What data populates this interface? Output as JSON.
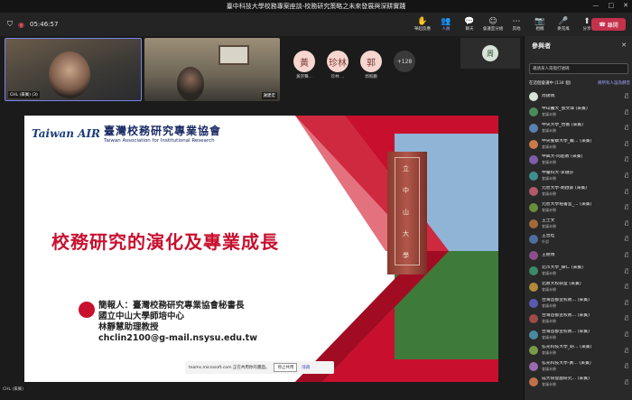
{
  "window": {
    "title": "臺中科技大學校務專案座談-校務研究策略之未來發展與深耕實踐",
    "controls": [
      "—",
      "□",
      "✕"
    ]
  },
  "toolbar": {
    "timer": "05:46:57",
    "tools": [
      {
        "icon": "✋",
        "label": "舉起反應"
      },
      {
        "icon": "👥",
        "label": "人員",
        "active": true
      },
      {
        "icon": "💬",
        "label": "聊天"
      },
      {
        "icon": "☺",
        "label": "會議室分組"
      },
      {
        "icon": "⋯",
        "label": "其他"
      },
      {
        "icon": "📷",
        "label": "相機"
      },
      {
        "icon": "🎤",
        "label": "麥克風"
      },
      {
        "icon": "⬆",
        "label": "分享"
      }
    ],
    "leave_label": "離開"
  },
  "stage": {
    "tile1_label": "CHL (來賓) (3)",
    "tile2_label": "謝建宏",
    "avatars": [
      {
        "initial": "黃",
        "name": "黃宗聲..."
      },
      {
        "initial": "珍林",
        "name": "珍林 ..."
      },
      {
        "initial": "郭",
        "name": "郭照鵬"
      },
      {
        "initial": "+128",
        "name": ""
      }
    ],
    "zhou_initial": "周",
    "share_label": "CHL (來賓)"
  },
  "slide": {
    "logo_mark": "Taiwan AIR",
    "logo_cn": "臺灣校務研究專業協會",
    "logo_en": "Taiwan Association for Institutional Research",
    "title": "校務研究的演化及專業成長",
    "presenter_lines": [
      "簡報人：臺灣校務研究專業協會秘書長",
      "國立中山大學師培中心",
      "林靜慧助理教授",
      "chclin2100@g-mail.nsysu.edu.tw"
    ],
    "tower_text": [
      "立",
      "中",
      "山",
      "大",
      "學"
    ]
  },
  "sharebar": {
    "text": "teams.microsoft.com 正在共用你的畫面。",
    "stop": "停止共用",
    "hide": "隱藏"
  },
  "panel": {
    "title": "參與者",
    "search_placeholder": "邀請某人或撥打號碼",
    "group_label": "在這個會議中 (134 個)",
    "group_action": "將所有人設為靜音",
    "participants": [
      {
        "name": "周錫佩",
        "role": "",
        "color": "#d9e2d8"
      },
      {
        "name": "中山醫大_張文瑋 (來賓)",
        "role": "會議未驗",
        "color": "#4b8b5c"
      },
      {
        "name": "中央大學_怡薔 (來賓)",
        "role": "會議未驗",
        "color": "#5a7fb0"
      },
      {
        "name": "中央警察大學_戴... (來賓)",
        "role": "會議未驗",
        "color": "#c97b48"
      },
      {
        "name": "中興大-阿超教 (來賓)",
        "role": "會議未驗",
        "color": "#7c5fa8"
      },
      {
        "name": "中臺科大-李融芬",
        "role": "會議未驗",
        "color": "#3f8f8f"
      },
      {
        "name": "元智大學-胡啟豪 (來賓)",
        "role": "會議未驗",
        "color": "#b05a6a"
      },
      {
        "name": "元智大學秘書室_... (來賓)",
        "role": "會議未驗",
        "color": "#6a8f3a"
      },
      {
        "name": "王士文",
        "role": "會議未驗",
        "color": "#a06a3a"
      },
      {
        "name": "王曾桂",
        "role": "外部",
        "color": "#4f6fa0"
      },
      {
        "name": "王撼博",
        "role": "",
        "color": "#8a4f8a"
      },
      {
        "name": "北市大學_歸仁 (來賓)",
        "role": "會議未驗",
        "color": "#3a8a6a"
      },
      {
        "name": "北教大校研室 (來賓)",
        "role": "會議未驗",
        "color": "#b08a3a"
      },
      {
        "name": "台灣首都宣校教... (來賓)",
        "role": "會議未驗",
        "color": "#5a5ab0"
      },
      {
        "name": "台灣首都宣校教... (來賓)",
        "role": "會議未驗",
        "color": "#a04a4a"
      },
      {
        "name": "台灣首都宣校教... (來賓)",
        "role": "會議未驗",
        "color": "#4a8aa0"
      },
      {
        "name": "弘光科技大學_研... (來賓)",
        "role": "會議未驗",
        "color": "#7a9a4a"
      },
      {
        "name": "弘光科技大學-黃... (來賓)",
        "role": "會議未驗",
        "color": "#9a6ab0"
      },
      {
        "name": "成大研發處研究... (來賓)",
        "role": "會議未驗",
        "color": "#c0704a"
      }
    ]
  }
}
